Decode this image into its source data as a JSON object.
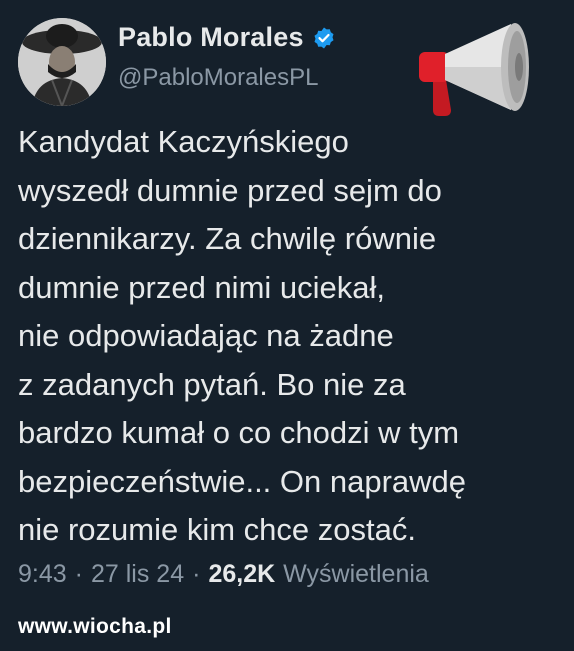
{
  "author": {
    "display_name": "Pablo Morales",
    "handle": "@PabloMoralesPL",
    "verified_icon": "verified-badge-icon",
    "avatar": "avatar-sepia-portrait"
  },
  "decoration_icon": "megaphone-icon",
  "tweet": {
    "lines": [
      "Kandydat Kaczyńskiego",
      "wyszedł dumnie przed sejm do",
      "dziennikarzy. Za chwilę równie",
      "dumnie przed nimi uciekał,",
      "nie odpowiadając na żadne",
      "z zadanych pytań. Bo nie za",
      "bardzo kumał o co chodzi w tym",
      "bezpieczeństwie... On naprawdę",
      "nie rozumie kim chce zostać."
    ]
  },
  "meta": {
    "time": "9:43",
    "separator": "·",
    "date": "27 lis 24",
    "views_count": "26,2K",
    "views_label": "Wyświetlenia"
  },
  "watermark": "www.wiocha.pl",
  "colors": {
    "background": "#15202b",
    "text": "#e7e9ea",
    "secondary": "#8b98a5",
    "verified": "#1d9bf0",
    "megaphone_red": "#e0202a"
  }
}
